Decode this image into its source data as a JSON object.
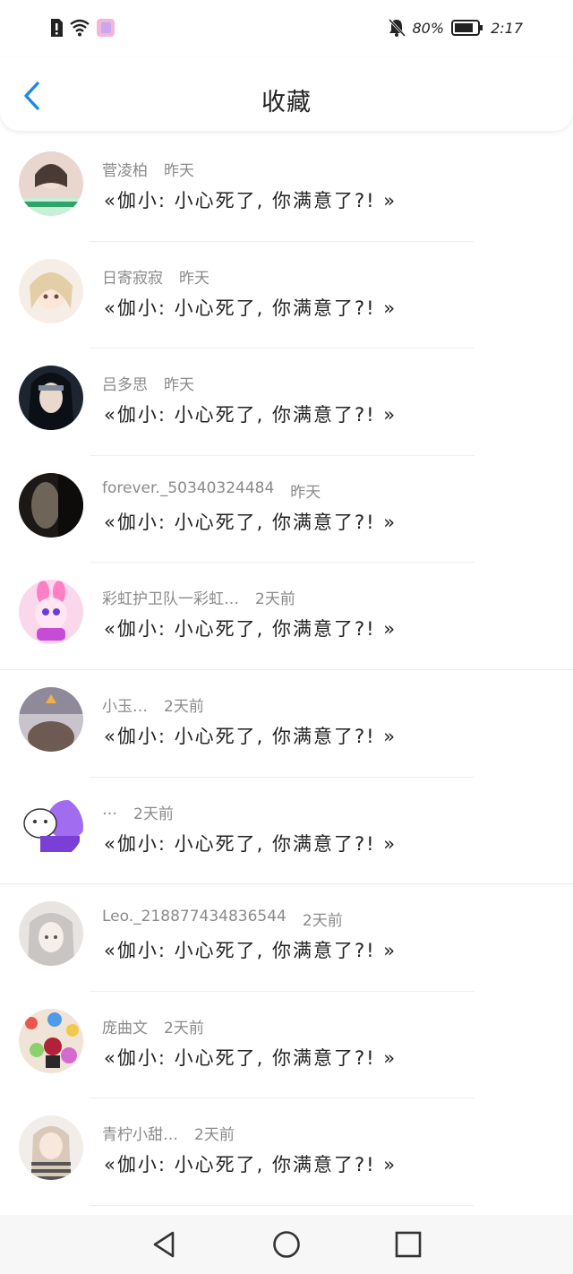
{
  "status_bar": {
    "battery": "80%",
    "time": "2:17",
    "icons": [
      "alert-icon",
      "wifi-icon",
      "app-icon",
      "mute-bell-icon",
      "battery-icon"
    ]
  },
  "header": {
    "title": "收藏",
    "back_icon": "back-chevron-icon",
    "accent_color": "#1e88e5"
  },
  "favorites": [
    {
      "name": "菅凌柏",
      "time": "昨天",
      "message": "«伽小: 小心死了, 你满意了?! »"
    },
    {
      "name": "日寄寂寂",
      "time": "昨天",
      "message": "«伽小: 小心死了, 你满意了?! »"
    },
    {
      "name": "吕多思",
      "time": "昨天",
      "message": "«伽小: 小心死了, 你满意了?! »"
    },
    {
      "name": "forever._50340324484",
      "time": "昨天",
      "message": "«伽小: 小心死了, 你满意了?! »"
    },
    {
      "name": "彩虹护卫队一彩虹…",
      "time": "2天前",
      "message": "«伽小: 小心死了, 你满意了?! »"
    },
    {
      "name": "小玉…",
      "time": "2天前",
      "message": "«伽小: 小心死了, 你满意了?! »"
    },
    {
      "name": "…",
      "time": "2天前",
      "message": "«伽小: 小心死了, 你满意了?! »"
    },
    {
      "name": "Leo._218877434836544",
      "time": "2天前",
      "message": "«伽小: 小心死了, 你满意了?! »"
    },
    {
      "name": "庞曲文",
      "time": "2天前",
      "message": "«伽小: 小心死了, 你满意了?! »"
    },
    {
      "name": "青柠小甜…",
      "time": "2天前",
      "message": "«伽小: 小心死了, 你满意了?! »"
    }
  ],
  "nav_bar": {
    "icons": [
      "nav-back-icon",
      "nav-home-icon",
      "nav-recents-icon"
    ]
  }
}
